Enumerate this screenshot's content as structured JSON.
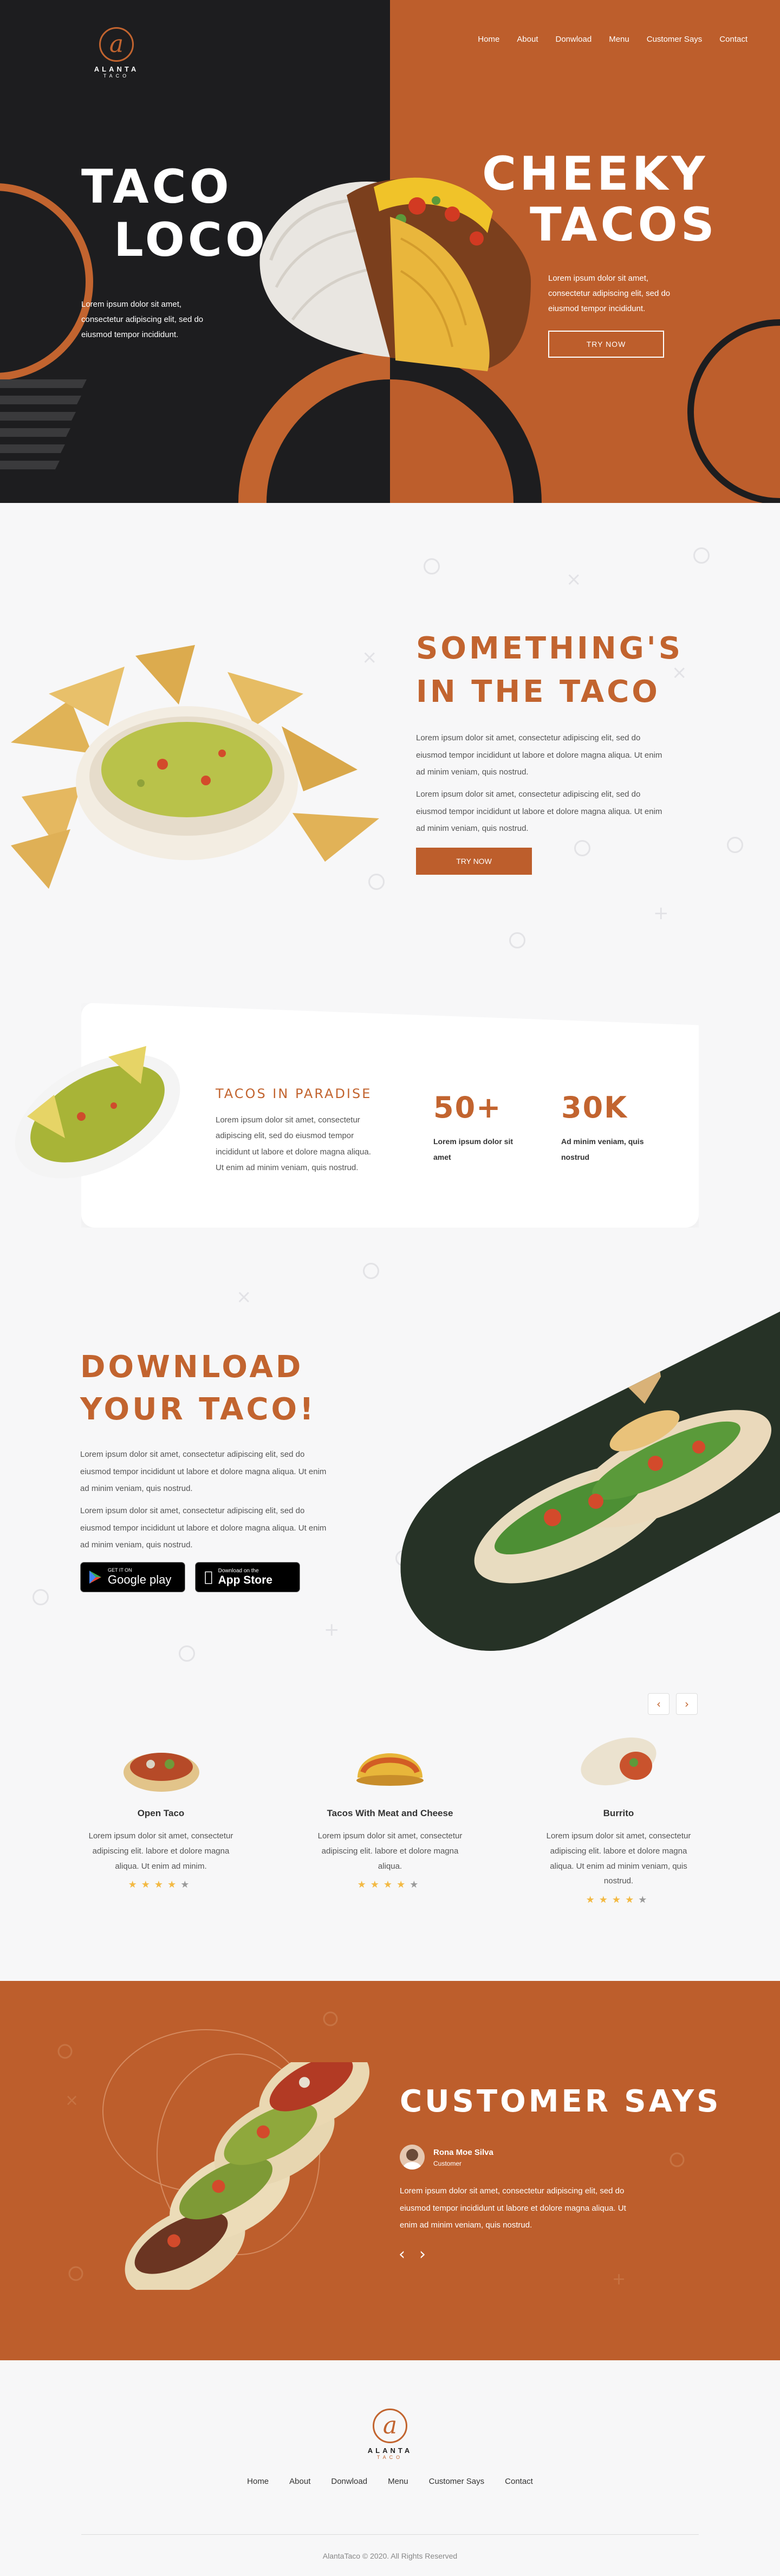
{
  "brand": {
    "logo_mark": "a",
    "name": "ALANTA",
    "sub": "TACO"
  },
  "nav": {
    "items": [
      "Home",
      "About",
      "Donwload",
      "Menu",
      "Customer Says",
      "Contact"
    ]
  },
  "hero": {
    "left_title_1": "TACO",
    "left_title_2": "LOCO",
    "left_text": [
      "Lorem ipsum dolor sit amet,",
      "consectetur adipiscing elit, sed do",
      "eiusmod tempor incididunt."
    ],
    "right_title_1": "CHEEKY",
    "right_title_2": "TACOS",
    "right_text": [
      "Lorem ipsum dolor sit amet,",
      "consectetur adipiscing elit, sed do",
      "eiusmod tempor incididunt."
    ],
    "button_label": "TRY NOW"
  },
  "about": {
    "title_1": "SOMETHING'S",
    "title_2": "IN THE TACO",
    "para_1": [
      "Lorem ipsum dolor sit amet, consectetur adipiscing elit, sed do",
      "eiusmod tempor incididunt ut labore et dolore magna aliqua. Ut enim",
      "ad minim veniam, quis nostrud."
    ],
    "para_2": [
      "Lorem ipsum dolor sit amet, consectetur adipiscing elit, sed do",
      "eiusmod tempor incididunt ut labore et dolore magna aliqua. Ut enim",
      "ad minim veniam, quis nostrud."
    ],
    "button_label": "TRY NOW"
  },
  "stats": {
    "title": "TACOS IN PARADISE",
    "text": [
      "Lorem ipsum dolor sit amet, consectetur",
      "adipiscing elit, sed do eiusmod tempor",
      "incididunt ut labore et dolore magna aliqua.",
      "Ut enim ad minim veniam, quis nostrud."
    ],
    "stat_1_value": "50+",
    "stat_1_label": [
      "Lorem ipsum dolor sit",
      "amet"
    ],
    "stat_2_value": "30K",
    "stat_2_label": [
      "Ad minim veniam, quis",
      "nostrud"
    ]
  },
  "download": {
    "title_1": "DOWNLOAD",
    "title_2": "YOUR TACO!",
    "para_1": [
      "Lorem ipsum dolor sit amet, consectetur adipiscing elit, sed do",
      "eiusmod tempor incididunt ut labore et dolore magna aliqua. Ut enim",
      "ad minim veniam, quis nostrud."
    ],
    "para_2": [
      "Lorem ipsum dolor sit amet, consectetur adipiscing elit, sed do",
      "eiusmod tempor incididunt ut labore et dolore magna aliqua. Ut enim",
      "ad minim veniam, quis nostrud."
    ],
    "google_small": "GET IT ON",
    "google_big": "Google play",
    "apple_small": "Download on the",
    "apple_big": "App Store"
  },
  "menu": {
    "prev_icon": "chevron-left-icon",
    "next_icon": "chevron-right-icon",
    "items": [
      {
        "name": "Open Taco",
        "desc": [
          "Lorem ipsum dolor sit amet, consectetur",
          "adipiscing elit. labore et dolore magna",
          "aliqua. Ut enim ad minim."
        ],
        "rating": 4
      },
      {
        "name": "Tacos With Meat and Cheese",
        "desc": [
          "Lorem ipsum dolor sit amet, consectetur",
          "adipiscing elit. labore et dolore magna",
          "aliqua."
        ],
        "rating": 4
      },
      {
        "name": "Burrito",
        "desc": [
          "Lorem ipsum dolor sit amet, consectetur",
          "adipiscing elit. labore et dolore magna",
          "aliqua. Ut enim ad minim veniam, quis",
          "nostrud."
        ],
        "rating": 4
      }
    ]
  },
  "testimonial": {
    "title": "CUSTOMER SAYS",
    "name": "Rona Moe Silva",
    "role": "Customer",
    "text": [
      "Lorem ipsum dolor sit amet, consectetur adipiscing elit, sed do",
      "eiusmod tempor incididunt ut labore et dolore magna aliqua. Ut",
      "enim ad minim veniam, quis nostrud."
    ]
  },
  "footer": {
    "copyright": "AlantaTaco © 2020. All Rights Reserved"
  },
  "colors": {
    "accent": "#bd5e2c",
    "dark": "#1d1d1f",
    "star": "#f3b943"
  }
}
